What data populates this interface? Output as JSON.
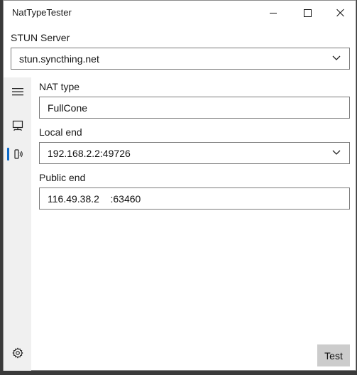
{
  "window": {
    "title": "NatTypeTester"
  },
  "stun": {
    "label": "STUN Server",
    "value": "stun.syncthing.net"
  },
  "nat_type": {
    "label": "NAT type",
    "value": "FullCone"
  },
  "local_end": {
    "label": "Local end",
    "value": "192.168.2.2:49726"
  },
  "public_end": {
    "label": "Public end",
    "value": "116.49.38.2    :63460"
  },
  "sidebar": {
    "items": [
      {
        "icon": "hamburger-menu-icon",
        "active": false
      },
      {
        "icon": "network-computer-icon",
        "active": false
      },
      {
        "icon": "wifi-device-icon",
        "active": true
      }
    ],
    "footer_icon": "gear-icon"
  },
  "actions": {
    "test_label": "Test"
  },
  "colors": {
    "accent": "#0a68c8",
    "sidebar_bg": "#f0f0f0",
    "button_bg": "#cccccc"
  }
}
